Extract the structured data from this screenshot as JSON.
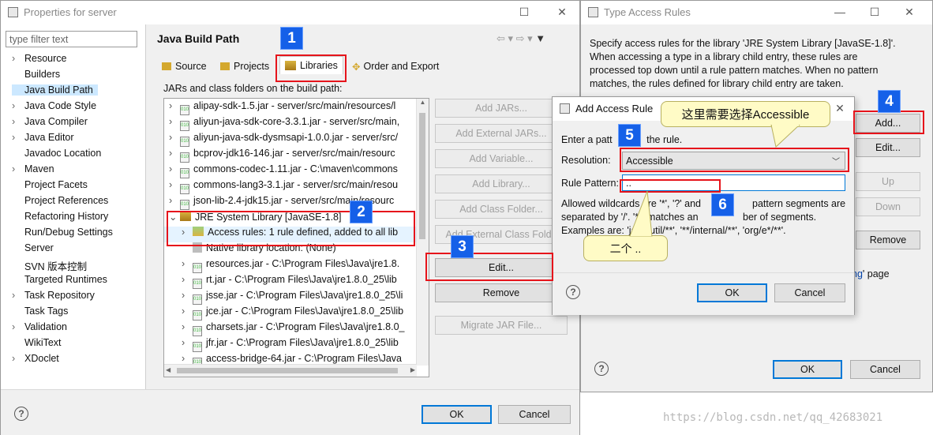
{
  "properties": {
    "title": "Properties for server",
    "filter_placeholder": "type filter text",
    "nav": [
      {
        "label": "Resource",
        "expandable": true
      },
      {
        "label": "Builders",
        "expandable": false
      },
      {
        "label": "Java Build Path",
        "expandable": false,
        "selected": true
      },
      {
        "label": "Java Code Style",
        "expandable": true
      },
      {
        "label": "Java Compiler",
        "expandable": true
      },
      {
        "label": "Java Editor",
        "expandable": true
      },
      {
        "label": "Javadoc Location",
        "expandable": false
      },
      {
        "label": "Maven",
        "expandable": true
      },
      {
        "label": "Project Facets",
        "expandable": false
      },
      {
        "label": "Project References",
        "expandable": false
      },
      {
        "label": "Refactoring History",
        "expandable": false
      },
      {
        "label": "Run/Debug Settings",
        "expandable": false
      },
      {
        "label": "Server",
        "expandable": false
      },
      {
        "label": "SVN 版本控制",
        "expandable": false
      },
      {
        "label": "Targeted Runtimes",
        "expandable": false
      },
      {
        "label": "Task Repository",
        "expandable": true
      },
      {
        "label": "Task Tags",
        "expandable": false
      },
      {
        "label": "Validation",
        "expandable": true
      },
      {
        "label": "WikiText",
        "expandable": false
      },
      {
        "label": "XDoclet",
        "expandable": true
      }
    ],
    "page_title": "Java Build Path",
    "tabs": [
      "Source",
      "Projects",
      "Libraries",
      "Order and Export"
    ],
    "jars_label": "JARs and class folders on the build path:",
    "tree": [
      {
        "text": "alipay-sdk-1.5.jar - server/src/main/resources/l",
        "level": 0,
        "type": "jar",
        "twisty": ">"
      },
      {
        "text": "aliyun-java-sdk-core-3.3.1.jar - server/src/main,",
        "level": 0,
        "type": "jar",
        "twisty": ">"
      },
      {
        "text": "aliyun-java-sdk-dysmsapi-1.0.0.jar - server/src/",
        "level": 0,
        "type": "jar",
        "twisty": ">"
      },
      {
        "text": "bcprov-jdk16-146.jar - server/src/main/resourc",
        "level": 0,
        "type": "jar",
        "twisty": ">"
      },
      {
        "text": "commons-codec-1.11.jar - C:\\maven\\commons",
        "level": 0,
        "type": "jar",
        "twisty": ">"
      },
      {
        "text": "commons-lang3-3.1.jar - server/src/main/resou",
        "level": 0,
        "type": "jar",
        "twisty": ">"
      },
      {
        "text": "json-lib-2.4-jdk15.jar - server/src/main/resourc",
        "level": 0,
        "type": "jar",
        "twisty": ">"
      },
      {
        "text": "JRE System Library [JavaSE-1.8]",
        "level": 0,
        "type": "lib",
        "twisty": "v"
      },
      {
        "text": "Access rules: 1 rule defined, added to all lib",
        "level": 1,
        "type": "rule",
        "twisty": ">"
      },
      {
        "text": "Native library location: (None)",
        "level": 1,
        "type": "native",
        "twisty": ""
      },
      {
        "text": "resources.jar - C:\\Program Files\\Java\\jre1.8.",
        "level": 1,
        "type": "jar",
        "twisty": ">"
      },
      {
        "text": "rt.jar - C:\\Program Files\\Java\\jre1.8.0_25\\lib",
        "level": 1,
        "type": "jar",
        "twisty": ">"
      },
      {
        "text": "jsse.jar - C:\\Program Files\\Java\\jre1.8.0_25\\li",
        "level": 1,
        "type": "jar",
        "twisty": ">"
      },
      {
        "text": "jce.jar - C:\\Program Files\\Java\\jre1.8.0_25\\lib",
        "level": 1,
        "type": "jar",
        "twisty": ">"
      },
      {
        "text": "charsets.jar - C:\\Program Files\\Java\\jre1.8.0_",
        "level": 1,
        "type": "jar",
        "twisty": ">"
      },
      {
        "text": "jfr.jar - C:\\Program Files\\Java\\jre1.8.0_25\\lib",
        "level": 1,
        "type": "jar",
        "twisty": ">"
      },
      {
        "text": "access-bridge-64.jar - C:\\Program Files\\Java",
        "level": 1,
        "type": "jar",
        "twisty": ">"
      }
    ],
    "side_buttons": [
      {
        "label": "Add JARs...",
        "enabled": false
      },
      {
        "label": "Add External JARs...",
        "enabled": false
      },
      {
        "label": "Add Variable...",
        "enabled": false
      },
      {
        "label": "Add Library...",
        "enabled": false
      },
      {
        "label": "Add Class Folder...",
        "enabled": false
      },
      {
        "label": "Add External Class Folde",
        "enabled": false
      },
      {
        "label": "Edit...",
        "enabled": true
      },
      {
        "label": "Remove",
        "enabled": true
      },
      {
        "label": "Migrate JAR File...",
        "enabled": false
      }
    ],
    "ok": "OK",
    "cancel": "Cancel"
  },
  "type_access": {
    "title": "Type Access Rules",
    "description": [
      "Specify access rules for the library 'JRE System Library [JavaSE-1.8]'.",
      "When accessing a type in a library child entry, these rules are",
      "processed top down until a rule pattern matches. When no pattern",
      "matches, the rules defined for library child entry are taken."
    ],
    "buttons": [
      {
        "label": "Add...",
        "enabled": true
      },
      {
        "label": "Edit...",
        "enabled": true
      },
      {
        "label": "Up",
        "enabled": false
      },
      {
        "label": "Down",
        "enabled": false
      },
      {
        "label": "Remove",
        "enabled": true
      }
    ],
    "link_tail_a": "ng",
    "link_tail_b": "' page",
    "ok": "OK",
    "cancel": "Cancel"
  },
  "add_rule": {
    "title": "Add Access Rule",
    "enter_text_a": "Enter a patt",
    "enter_text_b": "the rule.",
    "resolution_label": "Resolution:",
    "resolution_value": "Accessible",
    "pattern_label": "Rule Pattern:",
    "pattern_value": "..",
    "allowed_lines": [
      "Allowed wildcards are '*', '?' and",
      "separated by '/'. '**' matches an",
      "Examples are: 'java/util/**', '**/internal/**', 'org/e*/**'."
    ],
    "allowed_tail_1": "pattern segments are",
    "allowed_tail_2": "ber of segments.",
    "ok": "OK",
    "cancel": "Cancel"
  },
  "annotations": {
    "badges": [
      "1",
      "2",
      "3",
      "4",
      "5",
      "6"
    ],
    "callout_top": "这里需要选择Accessible",
    "callout_bottom": "二个 .."
  },
  "watermark": "https://blog.csdn.net/qq_42683021",
  "colors": {
    "badge_blue": "#1560e8",
    "highlight_red": "#e6141b",
    "callout_yellow": "#fffbc6",
    "selection": "#cce8ff",
    "link_blue": "#0645ad"
  }
}
